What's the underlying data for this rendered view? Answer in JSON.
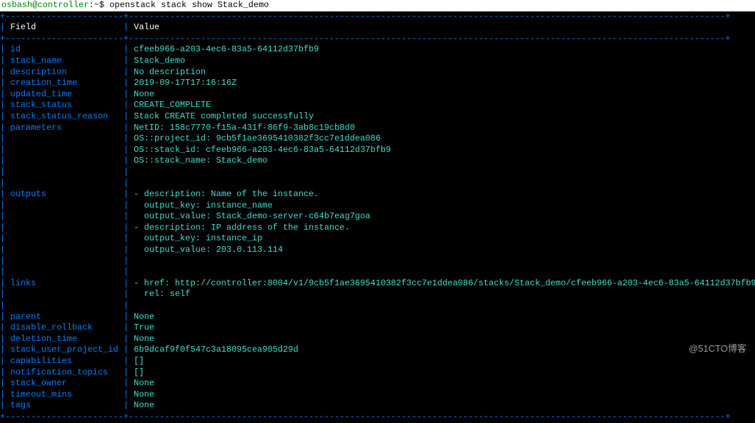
{
  "prompt": {
    "user_host": "osbash@controller",
    "path": "~",
    "symbol": "$",
    "command": "openstack stack show Stack_demo"
  },
  "table": {
    "header": {
      "field": "Field",
      "value": "Value"
    },
    "rows": [
      {
        "field": "id",
        "value": "cfeeb966-a203-4ec6-83a5-64112d37bfb9"
      },
      {
        "field": "stack_name",
        "value": "Stack_demo"
      },
      {
        "field": "description",
        "value": "No description"
      },
      {
        "field": "creation_time",
        "value": "2019-09-17T17:16:16Z"
      },
      {
        "field": "updated_time",
        "value": "None"
      },
      {
        "field": "stack_status",
        "value": "CREATE_COMPLETE"
      },
      {
        "field": "stack_status_reason",
        "value": "Stack CREATE completed successfully"
      },
      {
        "field": "parameters",
        "values": [
          "NetID: 158c7770-f15a-431f-86f9-3ab8c19cb8d0",
          "OS::project_id: 9cb5f1ae3695410382f3cc7e1ddea086",
          "OS::stack_id: cfeeb966-a203-4ec6-83a5-64112d37bfb9",
          "OS::stack_name: Stack_demo"
        ]
      },
      {
        "field": "outputs",
        "values": [
          "- description: Name of the instance.",
          "  output_key: instance_name",
          "  output_value: Stack_demo-server-c64b7eag7goa",
          "- description: IP address of the instance.",
          "  output_key: instance_ip",
          "  output_value: 203.0.113.114"
        ]
      },
      {
        "field": "links",
        "values": [
          "- href: http://controller:8004/v1/9cb5f1ae3695410382f3cc7e1ddea086/stacks/Stack_demo/cfeeb966-a203-4ec6-83a5-64112d37bfb9",
          "  rel: self"
        ]
      },
      {
        "field": "parent",
        "value": "None"
      },
      {
        "field": "disable_rollback",
        "value": "True"
      },
      {
        "field": "deletion_time",
        "value": "None"
      },
      {
        "field": "stack_user_project_id",
        "value": "6b9dcaf9f0f547c3a18095cea905d29d"
      },
      {
        "field": "capabilities",
        "value": "[]"
      },
      {
        "field": "notification_topics",
        "value": "[]"
      },
      {
        "field": "stack_owner",
        "value": "None"
      },
      {
        "field": "timeout_mins",
        "value": "None"
      },
      {
        "field": "tags",
        "value": "None"
      }
    ]
  },
  "watermark": "@51CTO博客",
  "col1_width": 21,
  "divider_top": "+-----------------------+--------------------------------------------------------------------------------------------------------------------+",
  "divider": "+-----------------------+--------------------------------------------------------------------------------------------------------------------+"
}
